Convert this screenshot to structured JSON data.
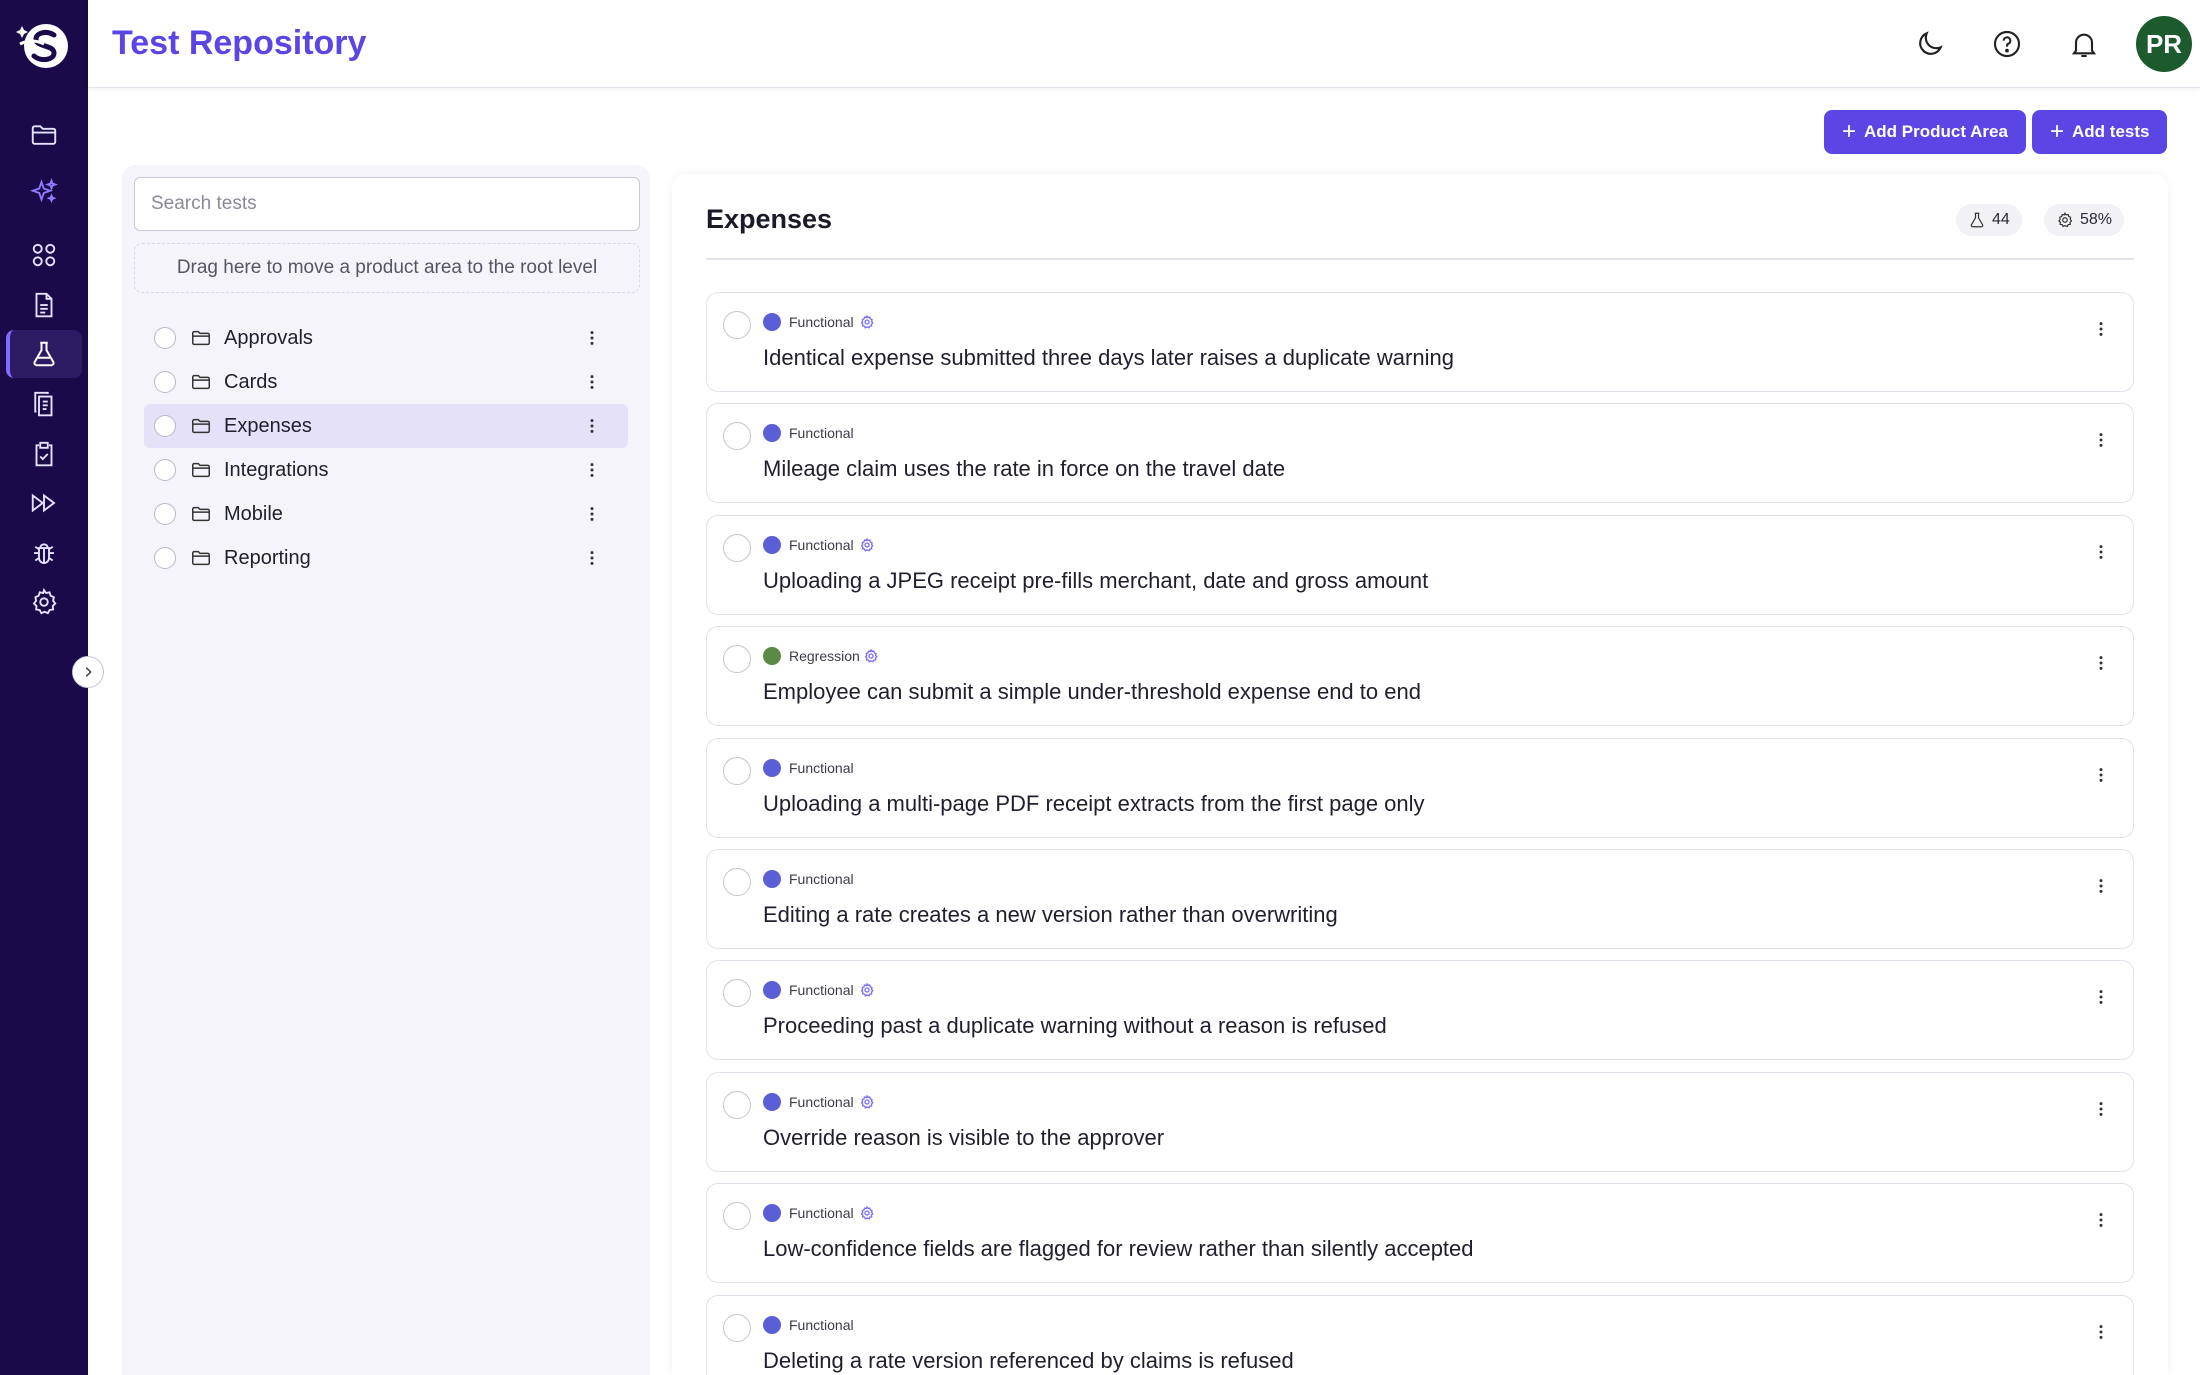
{
  "header": {
    "title": "Test Repository",
    "avatar_initials": "PR"
  },
  "actions": {
    "add_product_area": "Add Product Area",
    "add_tests": "Add tests"
  },
  "tree": {
    "search_placeholder": "Search tests",
    "drop_zone": "Drag here to move a product area to the root level",
    "items": [
      {
        "label": "Approvals",
        "active": false
      },
      {
        "label": "Cards",
        "active": false
      },
      {
        "label": "Expenses",
        "active": true
      },
      {
        "label": "Integrations",
        "active": false
      },
      {
        "label": "Mobile",
        "active": false
      },
      {
        "label": "Reporting",
        "active": false
      }
    ]
  },
  "area": {
    "title": "Expenses",
    "test_count": "44",
    "automation_pct": "58%"
  },
  "tests": [
    {
      "type": "Functional",
      "automated": true,
      "title": "Identical expense submitted three days later raises a duplicate warning"
    },
    {
      "type": "Functional",
      "automated": false,
      "title": "Mileage claim uses the rate in force on the travel date"
    },
    {
      "type": "Functional",
      "automated": true,
      "title": "Uploading a JPEG receipt pre-fills merchant, date and gross amount"
    },
    {
      "type": "Regression",
      "automated": true,
      "title": "Employee can submit a simple under-threshold expense end to end"
    },
    {
      "type": "Functional",
      "automated": false,
      "title": "Uploading a multi-page PDF receipt extracts from the first page only"
    },
    {
      "type": "Functional",
      "automated": false,
      "title": "Editing a rate creates a new version rather than overwriting"
    },
    {
      "type": "Functional",
      "automated": true,
      "title": "Proceeding past a duplicate warning without a reason is refused"
    },
    {
      "type": "Functional",
      "automated": true,
      "title": "Override reason is visible to the approver"
    },
    {
      "type": "Functional",
      "automated": true,
      "title": "Low-confidence fields are flagged for review rather than silently accepted"
    },
    {
      "type": "Functional",
      "automated": false,
      "title": "Deleting a rate version referenced by claims is refused"
    }
  ],
  "colors": {
    "brand": "#5a46e5",
    "rail": "#1b0a4a",
    "functional": "#5b5fd6",
    "regression": "#5a8a45"
  }
}
